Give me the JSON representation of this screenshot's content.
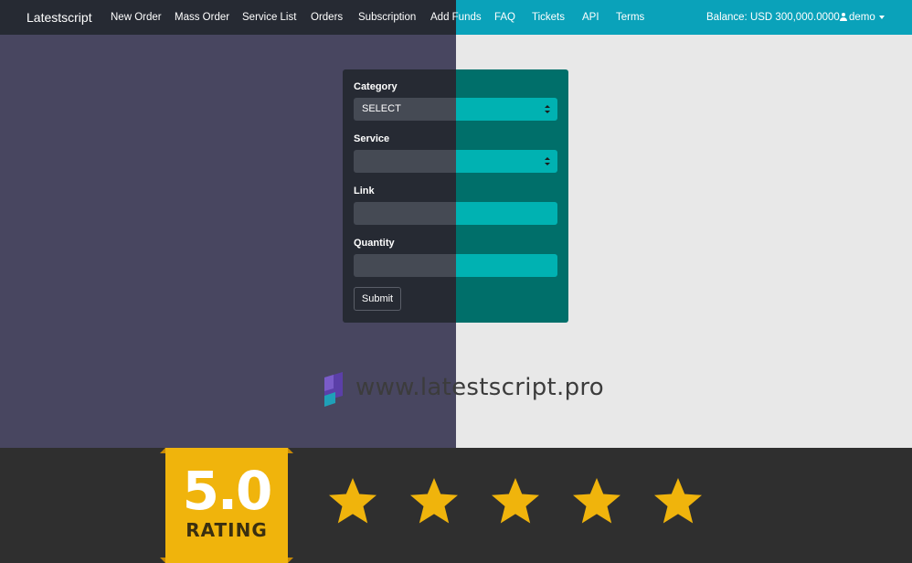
{
  "navbar": {
    "brand": "Latestscript",
    "items": [
      {
        "label": "New Order"
      },
      {
        "label": "Mass Order"
      },
      {
        "label": "Service List"
      },
      {
        "label": "Orders"
      },
      {
        "label": "Subscription"
      },
      {
        "label": "Add Funds"
      },
      {
        "label": "FAQ"
      },
      {
        "label": "Tickets"
      },
      {
        "label": "API"
      },
      {
        "label": "Terms"
      }
    ],
    "balance": "Balance: USD 300,000.0000",
    "user": "demo"
  },
  "form": {
    "category_label": "Category",
    "category_value": "SELECT",
    "service_label": "Service",
    "service_value": "",
    "link_label": "Link",
    "link_value": "",
    "quantity_label": "Quantity",
    "quantity_value": "",
    "submit_label": "Submit"
  },
  "watermark": {
    "text": "www.latestscript.pro"
  },
  "rating": {
    "score": "5.0",
    "label": "RATING",
    "stars": 5
  },
  "colors": {
    "nav_dark": "#262a33",
    "nav_teal": "#0aa2ba",
    "panel_teal": "#006f6a",
    "field_teal": "#00b2b2",
    "bg_purple": "#484660",
    "rating_gold": "#f0b40c"
  }
}
